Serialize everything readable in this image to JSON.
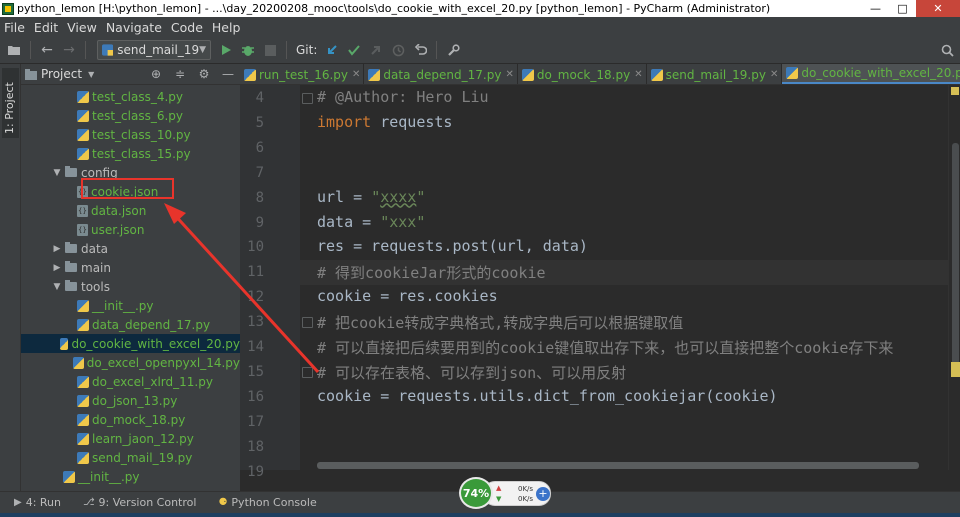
{
  "window": {
    "title": "python_lemon [H:\\python_lemon] - ...\\day_20200208_mooc\\tools\\do_cookie_with_excel_20.py [python_lemon] - PyCharm (Administrator)",
    "min": "—",
    "max": "□",
    "close": "✕"
  },
  "menu": [
    "File",
    "Edit",
    "View",
    "Navigate",
    "Code",
    "Help"
  ],
  "toolbar": {
    "run_config": "send_mail_19",
    "git_label": "Git:"
  },
  "left_strip": {
    "project_tab": "1: Project"
  },
  "project_panel": {
    "title": "Project"
  },
  "tree": [
    {
      "label": "test_class_4.py",
      "kind": "py",
      "indent": 3,
      "color": "green"
    },
    {
      "label": "test_class_6.py",
      "kind": "py",
      "indent": 3,
      "color": "green"
    },
    {
      "label": "test_class_10.py",
      "kind": "py",
      "indent": 3,
      "color": "green"
    },
    {
      "label": "test_class_15.py",
      "kind": "py",
      "indent": 3,
      "color": "green"
    },
    {
      "label": "config",
      "kind": "folder",
      "indent": 2,
      "expanded": true,
      "color": "white"
    },
    {
      "label": "cookie.json",
      "kind": "json",
      "indent": 3,
      "color": "green"
    },
    {
      "label": "data.json",
      "kind": "json",
      "indent": 3,
      "color": "green"
    },
    {
      "label": "user.json",
      "kind": "json",
      "indent": 3,
      "color": "green"
    },
    {
      "label": "data",
      "kind": "folder",
      "indent": 2,
      "expanded": false,
      "color": "white"
    },
    {
      "label": "main",
      "kind": "folder",
      "indent": 2,
      "expanded": false,
      "color": "white"
    },
    {
      "label": "tools",
      "kind": "folder",
      "indent": 2,
      "expanded": true,
      "color": "white"
    },
    {
      "label": "__init__.py",
      "kind": "py",
      "indent": 3,
      "color": "green"
    },
    {
      "label": "data_depend_17.py",
      "kind": "py",
      "indent": 3,
      "color": "green"
    },
    {
      "label": "do_cookie_with_excel_20.py",
      "kind": "py",
      "indent": 3,
      "color": "green",
      "selected": true
    },
    {
      "label": "do_excel_openpyxl_14.py",
      "kind": "py",
      "indent": 3,
      "color": "green"
    },
    {
      "label": "do_excel_xlrd_11.py",
      "kind": "py",
      "indent": 3,
      "color": "green"
    },
    {
      "label": "do_json_13.py",
      "kind": "py",
      "indent": 3,
      "color": "green"
    },
    {
      "label": "do_mock_18.py",
      "kind": "py",
      "indent": 3,
      "color": "green"
    },
    {
      "label": "learn_jaon_12.py",
      "kind": "py",
      "indent": 3,
      "color": "green"
    },
    {
      "label": "send_mail_19.py",
      "kind": "py",
      "indent": 3,
      "color": "green"
    },
    {
      "label": "__init__.py",
      "kind": "py",
      "indent": 2,
      "color": "green"
    }
  ],
  "tabs": [
    {
      "label": "run_test_16.py",
      "active": false
    },
    {
      "label": "data_depend_17.py",
      "active": false
    },
    {
      "label": "do_mock_18.py",
      "active": false
    },
    {
      "label": "send_mail_19.py",
      "active": false
    },
    {
      "label": "do_cookie_with_excel_20.py",
      "active": true
    }
  ],
  "tab_more": "≡",
  "editor": {
    "lines": [
      {
        "num": "4",
        "parts": [
          {
            "t": "# @Author: Hero Liu",
            "c": "cm"
          }
        ]
      },
      {
        "num": "5",
        "parts": [
          {
            "t": "import",
            "c": "kw"
          },
          {
            "t": " requests",
            "c": "plain"
          }
        ]
      },
      {
        "num": "6",
        "parts": []
      },
      {
        "num": "7",
        "parts": []
      },
      {
        "num": "8",
        "parts": [
          {
            "t": "url = ",
            "c": "plain"
          },
          {
            "t": "\"",
            "c": "str"
          },
          {
            "t": "xxxx",
            "c": "str wavy"
          },
          {
            "t": "\"",
            "c": "str"
          }
        ]
      },
      {
        "num": "9",
        "parts": [
          {
            "t": "data = ",
            "c": "plain"
          },
          {
            "t": "\"xxx\"",
            "c": "str"
          }
        ]
      },
      {
        "num": "10",
        "parts": [
          {
            "t": "res = requests.post(url, data)",
            "c": "plain"
          }
        ]
      },
      {
        "num": "11",
        "parts": [
          {
            "t": "# 得到cookieJar形式的cookie",
            "c": "cm"
          }
        ],
        "current": true
      },
      {
        "num": "12",
        "parts": [
          {
            "t": "cookie = res.cookies",
            "c": "plain"
          }
        ]
      },
      {
        "num": "13",
        "parts": [
          {
            "t": "# 把cookie转成字典格式,转成字典后可以根据键取值",
            "c": "cm"
          }
        ]
      },
      {
        "num": "14",
        "parts": [
          {
            "t": "# 可以直接把后续要用到的cookie键值取出存下来，也可以直接把整个cookie存下来",
            "c": "cm"
          }
        ]
      },
      {
        "num": "15",
        "parts": [
          {
            "t": "# 可以存在表格、可以存到json、可以用反射",
            "c": "cm"
          }
        ]
      },
      {
        "num": "16",
        "parts": [
          {
            "t": "cookie = requests.utils.dict_from_cookiejar(cookie)",
            "c": "plain"
          }
        ]
      },
      {
        "num": "17",
        "parts": []
      },
      {
        "num": "18",
        "parts": []
      },
      {
        "num": "19",
        "parts": []
      }
    ]
  },
  "bottom": {
    "run": "4: Run",
    "vcs": "9: Version Control",
    "console": "Python Console"
  },
  "net_widget": {
    "percent": "74%",
    "up": "0K/s",
    "down": "0K/s"
  },
  "colors": {
    "annotation": "#e8342b",
    "accent": "#4a88c7",
    "file_green": "#62b543"
  }
}
